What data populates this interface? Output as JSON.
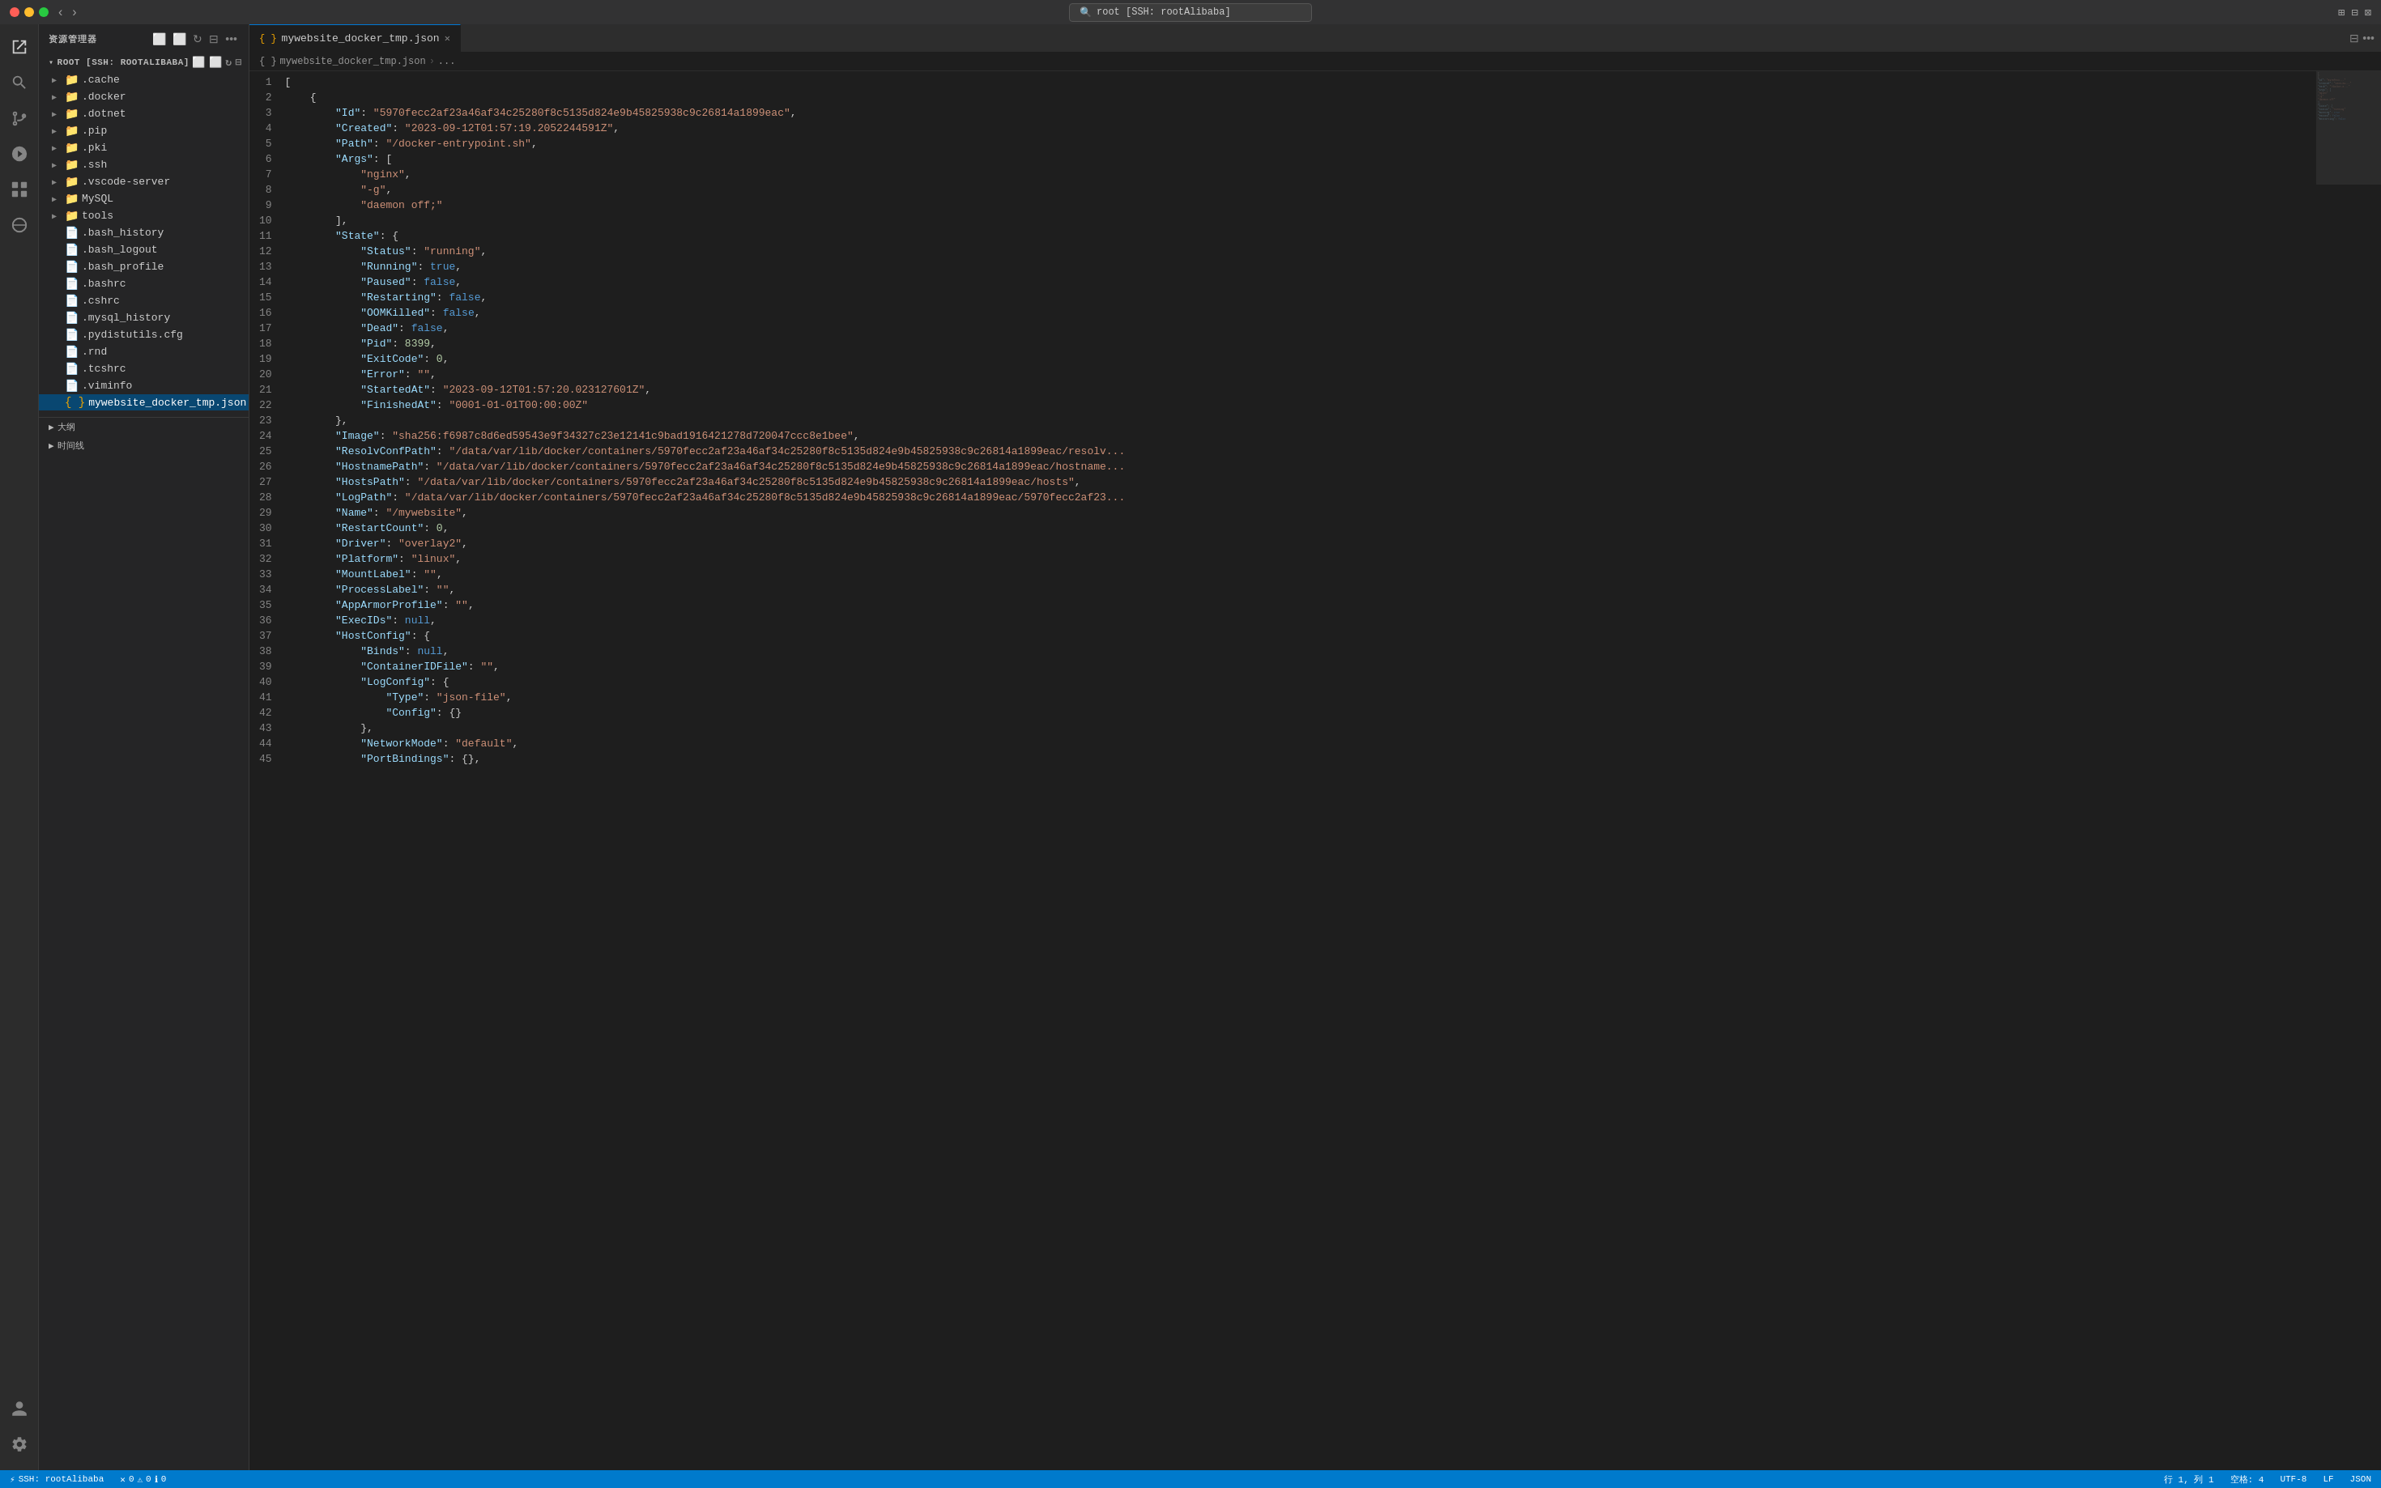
{
  "titleBar": {
    "searchText": "root [SSH: rootAlibaba]"
  },
  "sidebar": {
    "header": "资源管理器",
    "rootLabel": "ROOT [SSH: ROOTALIBABA]",
    "items": [
      {
        "type": "folder",
        "label": ".cache",
        "level": 1,
        "expanded": false
      },
      {
        "type": "folder",
        "label": ".docker",
        "level": 1,
        "expanded": false
      },
      {
        "type": "folder",
        "label": ".dotnet",
        "level": 1,
        "expanded": false
      },
      {
        "type": "folder",
        "label": ".pip",
        "level": 1,
        "expanded": false
      },
      {
        "type": "folder",
        "label": ".pki",
        "level": 1,
        "expanded": false
      },
      {
        "type": "folder",
        "label": ".ssh",
        "level": 1,
        "expanded": false
      },
      {
        "type": "folder",
        "label": ".vscode-server",
        "level": 1,
        "expanded": false
      },
      {
        "type": "folder",
        "label": "MySQL",
        "level": 1,
        "expanded": false
      },
      {
        "type": "folder",
        "label": "tools",
        "level": 1,
        "expanded": false
      },
      {
        "type": "file",
        "label": ".bash_history",
        "level": 1
      },
      {
        "type": "file",
        "label": ".bash_logout",
        "level": 1
      },
      {
        "type": "file",
        "label": ".bash_profile",
        "level": 1
      },
      {
        "type": "file",
        "label": ".bashrc",
        "level": 1
      },
      {
        "type": "file",
        "label": ".cshrc",
        "level": 1
      },
      {
        "type": "file",
        "label": ".mysql_history",
        "level": 1
      },
      {
        "type": "file",
        "label": ".pydistutils.cfg",
        "level": 1
      },
      {
        "type": "file",
        "label": ".rnd",
        "level": 1
      },
      {
        "type": "file",
        "label": ".tcshrc",
        "level": 1
      },
      {
        "type": "file",
        "label": ".viminfo",
        "level": 1
      },
      {
        "type": "file-json",
        "label": "mywebsite_docker_tmp.json",
        "level": 1,
        "active": true
      }
    ]
  },
  "tabs": [
    {
      "label": "mywebsite_docker_tmp.json",
      "active": true,
      "icon": "{ }"
    }
  ],
  "breadcrumb": {
    "parts": [
      "mywebsite_docker_tmp.json",
      "..."
    ]
  },
  "editor": {
    "lines": [
      {
        "num": 1,
        "content": "["
      },
      {
        "num": 2,
        "content": "    {"
      },
      {
        "num": 3,
        "content": "        \"Id\": \"5970fecc2af23a46af34c25280f8c5135d824e9b45825938c9c26814a1899eac\","
      },
      {
        "num": 4,
        "content": "        \"Created\": \"2023-09-12T01:57:19.2052244591Z\","
      },
      {
        "num": 5,
        "content": "        \"Path\": \"/docker-entrypoint.sh\","
      },
      {
        "num": 6,
        "content": "        \"Args\": ["
      },
      {
        "num": 7,
        "content": "            \"nginx\","
      },
      {
        "num": 8,
        "content": "            \"-g\","
      },
      {
        "num": 9,
        "content": "            \"daemon off;\""
      },
      {
        "num": 10,
        "content": "        ],"
      },
      {
        "num": 11,
        "content": "        \"State\": {"
      },
      {
        "num": 12,
        "content": "            \"Status\": \"running\","
      },
      {
        "num": 13,
        "content": "            \"Running\": true,"
      },
      {
        "num": 14,
        "content": "            \"Paused\": false,"
      },
      {
        "num": 15,
        "content": "            \"Restarting\": false,"
      },
      {
        "num": 16,
        "content": "            \"OOMKilled\": false,"
      },
      {
        "num": 17,
        "content": "            \"Dead\": false,"
      },
      {
        "num": 18,
        "content": "            \"Pid\": 8399,"
      },
      {
        "num": 19,
        "content": "            \"ExitCode\": 0,"
      },
      {
        "num": 20,
        "content": "            \"Error\": \"\","
      },
      {
        "num": 21,
        "content": "            \"StartedAt\": \"2023-09-12T01:57:20.023127601Z\","
      },
      {
        "num": 22,
        "content": "            \"FinishedAt\": \"0001-01-01T00:00:00Z\""
      },
      {
        "num": 23,
        "content": "        },"
      },
      {
        "num": 24,
        "content": "        \"Image\": \"sha256:f6987c8d6ed59543e9f34327c23e12141c9bad1916421278d720047ccc8e1bee\","
      },
      {
        "num": 25,
        "content": "        \"ResolvConfPath\": \"/data/var/lib/docker/containers/5970fecc2af23a46af34c25280f8c5135d824e9b45825938c9c26814a1899eac/resolv..."
      },
      {
        "num": 26,
        "content": "        \"HostnamePath\": \"/data/var/lib/docker/containers/5970fecc2af23a46af34c25280f8c5135d824e9b45825938c9c26814a1899eac/hostname..."
      },
      {
        "num": 27,
        "content": "        \"HostsPath\": \"/data/var/lib/docker/containers/5970fecc2af23a46af34c25280f8c5135d824e9b45825938c9c26814a1899eac/hosts\","
      },
      {
        "num": 28,
        "content": "        \"LogPath\": \"/data/var/lib/docker/containers/5970fecc2af23a46af34c25280f8c5135d824e9b45825938c9c26814a1899eac/5970fecc2af23..."
      },
      {
        "num": 29,
        "content": "        \"Name\": \"/mywebsite\","
      },
      {
        "num": 30,
        "content": "        \"RestartCount\": 0,"
      },
      {
        "num": 31,
        "content": "        \"Driver\": \"overlay2\","
      },
      {
        "num": 32,
        "content": "        \"Platform\": \"linux\","
      },
      {
        "num": 33,
        "content": "        \"MountLabel\": \"\","
      },
      {
        "num": 34,
        "content": "        \"ProcessLabel\": \"\","
      },
      {
        "num": 35,
        "content": "        \"AppArmorProfile\": \"\","
      },
      {
        "num": 36,
        "content": "        \"ExecIDs\": null,"
      },
      {
        "num": 37,
        "content": "        \"HostConfig\": {"
      },
      {
        "num": 38,
        "content": "            \"Binds\": null,"
      },
      {
        "num": 39,
        "content": "            \"ContainerIDFile\": \"\","
      },
      {
        "num": 40,
        "content": "            \"LogConfig\": {"
      },
      {
        "num": 41,
        "content": "                \"Type\": \"json-file\","
      },
      {
        "num": 42,
        "content": "                \"Config\": {}"
      },
      {
        "num": 43,
        "content": "            },"
      },
      {
        "num": 44,
        "content": "            \"NetworkMode\": \"default\","
      },
      {
        "num": 45,
        "content": "            \"PortBindings\": {},"
      }
    ]
  },
  "statusBar": {
    "sshLabel": "SSH: rootAlibaba",
    "errors": "0",
    "warnings": "0",
    "info": "0",
    "row": "行 1, 列 1",
    "spaces": "空格: 4",
    "encoding": "UTF-8",
    "lineEnding": "LF",
    "language": "JSON",
    "outline": "大纲",
    "timeline": "时间线"
  }
}
